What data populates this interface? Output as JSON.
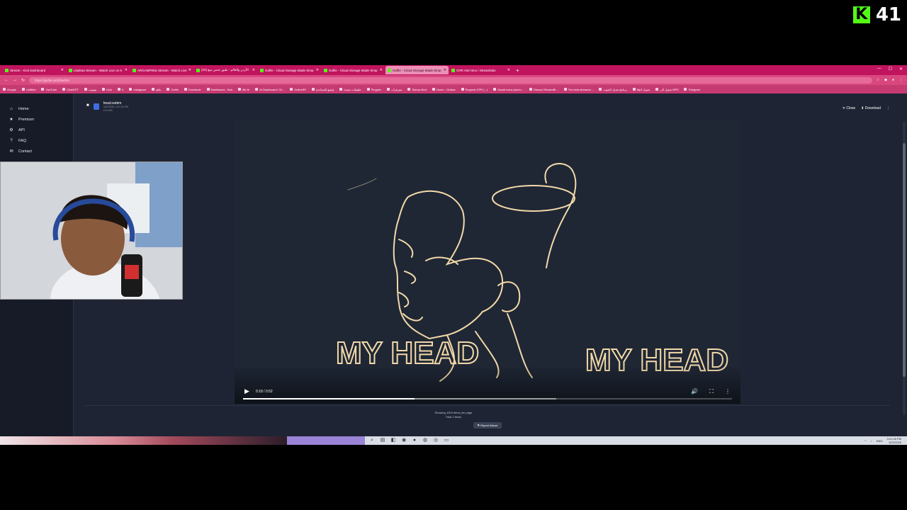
{
  "overlay": {
    "viewer_count": "41",
    "logo_letter": "K"
  },
  "browser": {
    "tabs": [
      {
        "title": "Stream - Kick Dashboard",
        "active": false
      },
      {
        "title": "Lladnan Stream - Watch Live on K",
        "active": false
      },
      {
        "title": "ARGAMPiKlw Stream - Watch Live",
        "active": false
      },
      {
        "title": "(24) الأردن والعالم - طيور جنس ينبع",
        "active": false
      },
      {
        "title": "Gofile - Cloud Storage Made Simp",
        "active": false
      },
      {
        "title": "Gofile - Cloud Storage Made Simp",
        "active": false
      },
      {
        "title": "Gofile - Cloud Storage Made Simp",
        "active": true
      },
      {
        "title": "CRR Alert Box / Streamlabs",
        "active": false
      }
    ],
    "url": "https://gofile.io/d/Zsef2m",
    "bookmarks": [
      "Google",
      "Untitled",
      "YouTube",
      "ChatGPT",
      "يوتيوب",
      "Kick",
      "X",
      "Instagram",
      "نتائج",
      "Gofile",
      "Facebook",
      "Dashboard - Kick",
      "8th fe",
      "AI Dashboard / St...",
      "OnlineSP",
      "(وضع المساعد)",
      "تطبيقات مفيدة",
      "Pingwin",
      "سيرفرات",
      "Stamp Mod",
      "Home - Outlaw",
      "Request CPR (...)",
      "Social icons (micro...",
      "Discord StreamBi...",
      "The best streamer...",
      "برنامج تعديل الصوت",
      "Mp3 تحويل",
      "تحويل الى MP3",
      "Telegram"
    ]
  },
  "sidebar": {
    "items": [
      {
        "label": "Home",
        "icon": "home-icon",
        "glyph": "⌂"
      },
      {
        "label": "Premium",
        "icon": "star-icon",
        "glyph": "★"
      },
      {
        "label": "API",
        "icon": "code-icon",
        "glyph": "⚙"
      },
      {
        "label": "FAQ",
        "icon": "question-icon",
        "glyph": "?"
      },
      {
        "label": "Contact",
        "icon": "mail-icon",
        "glyph": "✉"
      }
    ]
  },
  "file": {
    "name": "head.webm",
    "date": "3/22/2026, 3:21:32 PM",
    "size": "19.5 MB"
  },
  "actions": {
    "close_label": "Close",
    "download_label": "Download"
  },
  "video": {
    "overlay_text_left": "MY HEAD",
    "overlay_text_right": "MY HEAD",
    "time": "0:18 / 0:52",
    "progress": 0.35,
    "buffered": 0.64
  },
  "footer": {
    "showing": "Showing 1000 items per page",
    "total": "Total 1 items",
    "report_label": "Report Abuse"
  },
  "taskbar": {
    "lang": "ENG",
    "time": "3:21:35 PM",
    "date": "3/22/2026"
  },
  "colors": {
    "tabbar": "#c0145e",
    "kick_green": "#53fc18",
    "page_bg": "#1e2433"
  }
}
